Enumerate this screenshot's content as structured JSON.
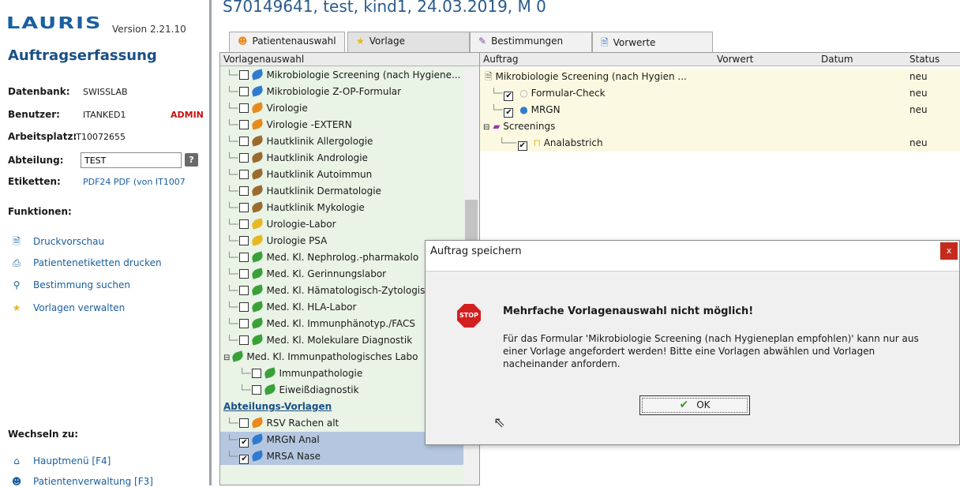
{
  "app": {
    "logo": "LAURIS",
    "version": "Version 2.21.10",
    "title": "Auftragserfassung"
  },
  "sidebar": {
    "datenbank_label": "Datenbank:",
    "datenbank_value": "SWISSLAB",
    "benutzer_label": "Benutzer:",
    "benutzer_value": "ITANKED1",
    "benutzer_role": "ADMIN",
    "arbeitsplatz_label": "Arbeitsplatz:",
    "arbeitsplatz_value": "IT10072655",
    "abteilung_label": "Abteilung:",
    "abteilung_value": "TEST",
    "etiketten_label": "Etiketten:",
    "etiketten_value": "PDF24 PDF (von IT1007",
    "funktionen_label": "Funktionen:",
    "funktionen": [
      {
        "label": "Druckvorschau",
        "icon": "print-preview-icon"
      },
      {
        "label": "Patientenetiketten drucken",
        "icon": "printer-icon"
      },
      {
        "label": "Bestimmung suchen",
        "icon": "search-icon"
      },
      {
        "label": "Vorlagen verwalten",
        "icon": "star-icon"
      }
    ],
    "wechseln_label": "Wechseln zu:",
    "wechseln": [
      {
        "label": "Hauptmenü [F4]",
        "icon": "home-icon"
      },
      {
        "label": "Patientenverwaltung [F3]",
        "icon": "person-icon"
      }
    ]
  },
  "header": {
    "patient": "S70149641, test, kind1, 24.03.2019, M 0"
  },
  "tabs": [
    {
      "label": "Patientenauswahl",
      "icon": "person-icon"
    },
    {
      "label": "Vorlage",
      "icon": "star-icon"
    },
    {
      "label": "Bestimmungen",
      "icon": "edit-icon"
    },
    {
      "label": "Vorwerte",
      "icon": "document-icon"
    }
  ],
  "vorlagen": {
    "header": "Vorlagenauswahl",
    "items": [
      {
        "label": "Mikrobiologie Screening (nach Hygiene...",
        "checked": false,
        "color": "#2f7bd0"
      },
      {
        "label": "Mikrobiologie Z-OP-Formular",
        "checked": false,
        "color": "#2f7bd0"
      },
      {
        "label": "Virologie",
        "checked": false,
        "color": "#e98a1c"
      },
      {
        "label": "Virologie -EXTERN",
        "checked": false,
        "color": "#e98a1c"
      },
      {
        "label": "Hautklinik Allergologie",
        "checked": false,
        "color": "#9b6a2f"
      },
      {
        "label": "Hautklinik Andrologie",
        "checked": false,
        "color": "#9b6a2f"
      },
      {
        "label": "Hautklinik Autoimmun",
        "checked": false,
        "color": "#9b6a2f"
      },
      {
        "label": "Hautklinik Dermatologie",
        "checked": false,
        "color": "#9b6a2f"
      },
      {
        "label": "Hautklinik Mykologie",
        "checked": false,
        "color": "#9b6a2f"
      },
      {
        "label": "Urologie-Labor",
        "checked": false,
        "color": "#e6b821"
      },
      {
        "label": "Urologie PSA",
        "checked": false,
        "color": "#e6b821"
      },
      {
        "label": "Med. Kl. Nephrolog.-pharmakolo",
        "checked": false,
        "color": "#3aa03a"
      },
      {
        "label": "Med. Kl. Gerinnungslabor",
        "checked": false,
        "color": "#3aa03a"
      },
      {
        "label": "Med. Kl. Hämatologisch-Zytologis",
        "checked": false,
        "color": "#3aa03a"
      },
      {
        "label": "Med. Kl. HLA-Labor",
        "checked": false,
        "color": "#3aa03a"
      },
      {
        "label": "Med. Kl. Immunphänotyp./FACS",
        "checked": false,
        "color": "#3aa03a"
      },
      {
        "label": "Med. Kl. Molekulare Diagnostik",
        "checked": false,
        "color": "#3aa03a"
      }
    ],
    "group_label": "Med. Kl. Immunpathologisches Labo",
    "group_children": [
      {
        "label": "Immunpathologie",
        "checked": false
      },
      {
        "label": "Eiweißdiagnostik",
        "checked": false
      }
    ],
    "section_label": "Abteilungs-Vorlagen",
    "section_items": [
      {
        "label": "RSV Rachen alt",
        "checked": false,
        "color": "#e98a1c"
      },
      {
        "label": "MRGN Anal",
        "checked": true,
        "color": "#2f7bd0"
      },
      {
        "label": "MRSA Nase",
        "checked": true,
        "color": "#2f7bd0"
      }
    ]
  },
  "auftrag": {
    "headers": {
      "auftrag": "Auftrag",
      "vorwert": "Vorwert",
      "datum": "Datum",
      "status": "Status"
    },
    "rows": [
      {
        "label": "Mikrobiologie Screening (nach Hygien ...",
        "status": "neu"
      },
      {
        "label": "Formular-Check",
        "status": "neu"
      },
      {
        "label": "MRGN",
        "status": "neu"
      },
      {
        "label": "Screenings",
        "status": ""
      },
      {
        "label": "Analabstrich",
        "status": "neu"
      }
    ]
  },
  "dialog": {
    "title": "Auftrag speichern",
    "close": "x",
    "stop_label": "STOP",
    "heading": "Mehrfache Vorlagenauswahl nicht möglich!",
    "message": "Für das Formular 'Mikrobiologie Screening (nach Hygieneplan empfohlen)' kann nur aus einer Vorlage angefordert werden! Bitte eine Vorlagen abwählen und Vorlagen nacheinander anfordern.",
    "ok_label": "OK"
  }
}
